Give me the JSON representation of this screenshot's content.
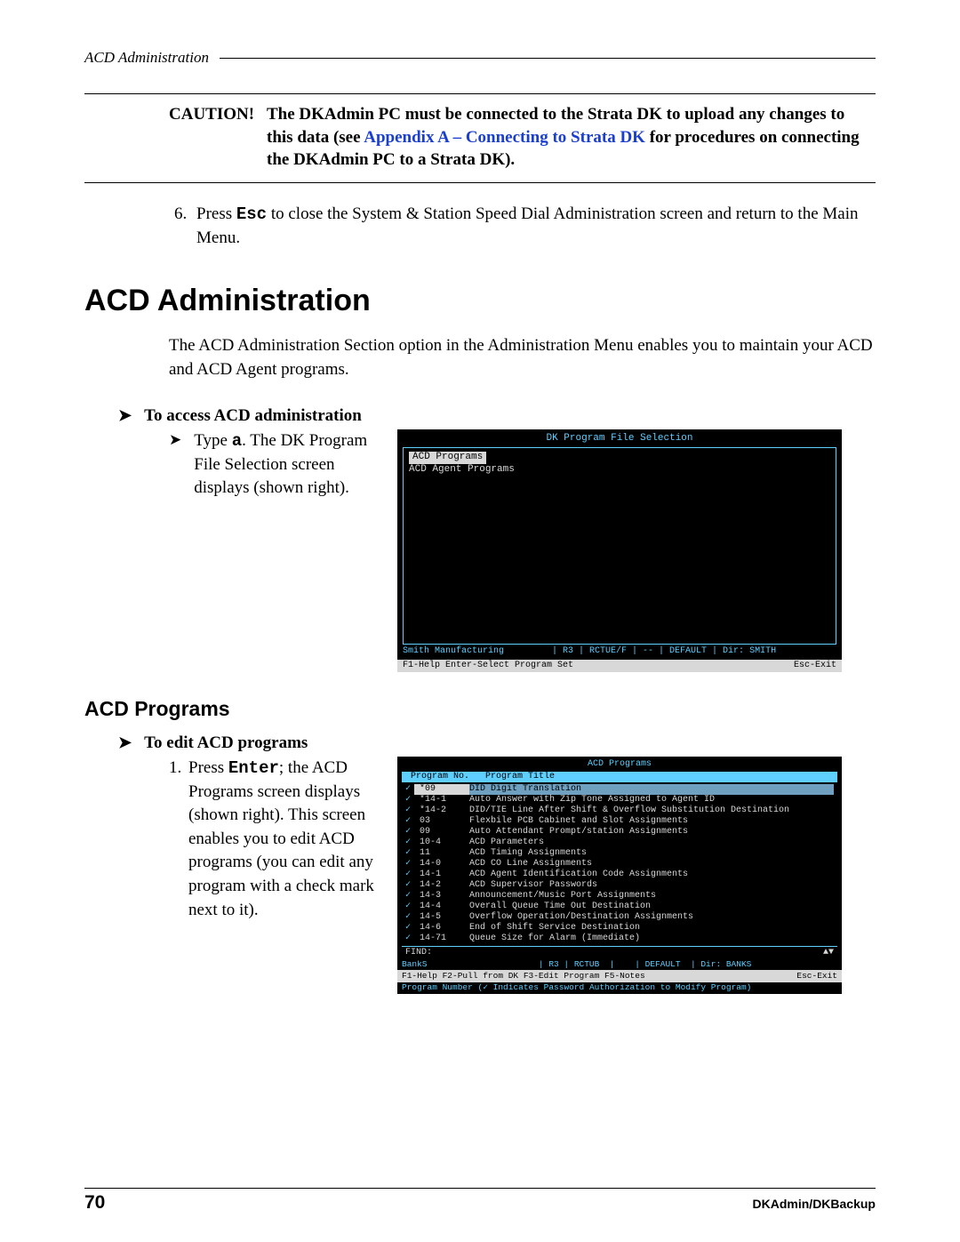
{
  "header": {
    "running_title": "ACD Administration"
  },
  "caution": {
    "label": "CAUTION!",
    "text_before": "The DKAdmin PC must be connected to the Strata DK to upload any changes to this data (see ",
    "link_text": "Appendix A – Connecting to Strata DK",
    "text_after": " for procedures on connecting the DKAdmin PC to a Strata DK)."
  },
  "step6": {
    "number": "6.",
    "before_esc": "Press ",
    "esc": "Esc",
    "after_esc": " to close the System & Station Speed Dial Administration screen and return to the Main Menu."
  },
  "h1": "ACD Administration",
  "intro": "The ACD Administration Section option in the Administration Menu enables you to maintain your ACD and ACD Agent programs.",
  "proc1": {
    "heading": "To access ACD administration",
    "step_before": "Type ",
    "step_key": "a",
    "step_after": ". The DK Program File Selection screen displays (shown right)."
  },
  "term1": {
    "title": "DK Program File Selection",
    "item_selected": "ACD Programs",
    "item2": "ACD Agent Programs",
    "status": "Smith Manufacturing         | R3 | RCTUE/F | -- | DEFAULT | Dir: SMITH",
    "foot_left": "F1-Help  Enter-Select Program Set",
    "foot_right": "Esc-Exit"
  },
  "h2": "ACD Programs",
  "proc2": {
    "heading": "To edit ACD programs",
    "num": "1.",
    "before_enter": "Press ",
    "enter": "Enter",
    "after_enter": "; the ACD Programs screen displays (shown right). This screen enables you to edit ACD programs (you can edit any program with a check mark next to it)."
  },
  "term2": {
    "title": "ACD Programs",
    "col1": "Program No.",
    "col2": "Program Title",
    "rows": [
      {
        "chk": "✓",
        "pn": "*09",
        "pt": "DID Digit Translation",
        "sel": true
      },
      {
        "chk": "✓",
        "pn": "*14-1",
        "pt": "Auto Answer with Zip Tone Assigned to Agent ID"
      },
      {
        "chk": "✓",
        "pn": "*14-2",
        "pt": "DID/TIE Line After Shift & Overflow Substitution Destination"
      },
      {
        "chk": "✓",
        "pn": "03",
        "pt": "Flexbile PCB Cabinet and Slot Assignments"
      },
      {
        "chk": "✓",
        "pn": "09",
        "pt": "Auto Attendant Prompt/station Assignments"
      },
      {
        "chk": "✓",
        "pn": "10-4",
        "pt": "ACD Parameters"
      },
      {
        "chk": "✓",
        "pn": "11",
        "pt": "ACD Timing Assignments"
      },
      {
        "chk": "✓",
        "pn": "14-0",
        "pt": "ACD CO Line Assignments"
      },
      {
        "chk": "✓",
        "pn": "14-1",
        "pt": "ACD Agent Identification Code Assignments"
      },
      {
        "chk": "✓",
        "pn": "14-2",
        "pt": "ACD Supervisor Passwords"
      },
      {
        "chk": "✓",
        "pn": "14-3",
        "pt": "Announcement/Music Port Assignments"
      },
      {
        "chk": "✓",
        "pn": "14-4",
        "pt": "Overall Queue Time Out Destination"
      },
      {
        "chk": "✓",
        "pn": "14-5",
        "pt": "Overflow Operation/Destination Assignments"
      },
      {
        "chk": "✓",
        "pn": "14-6",
        "pt": "End of Shift Service Destination"
      },
      {
        "chk": "✓",
        "pn": "14-71",
        "pt": "Queue Size for Alarm (Immediate)"
      }
    ],
    "find_label": "FIND:",
    "find_right": "▲▼",
    "status": "BankS                      | R3 | RCTUB  |    | DEFAULT  | Dir: BANKS",
    "foot_left": "F1-Help  F2-Pull from DK  F3-Edit Program  F5-Notes",
    "foot_right": "Esc-Exit",
    "footnote": "Program Number (✓ Indicates Password Authorization to Modify Program)"
  },
  "footer": {
    "page": "70",
    "doc": "DKAdmin/DKBackup"
  }
}
